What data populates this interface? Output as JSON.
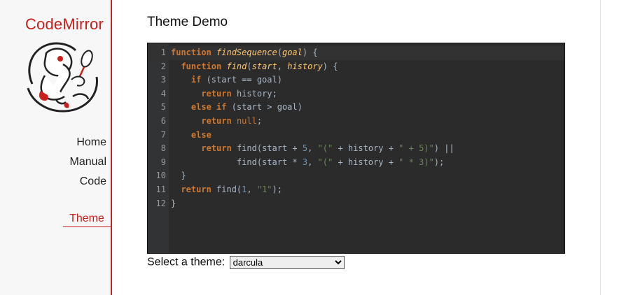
{
  "sidebar": {
    "brand": "CodeMirror",
    "nav": [
      {
        "label": "Home"
      },
      {
        "label": "Manual"
      },
      {
        "label": "Code"
      },
      {
        "label": "Theme",
        "active": true
      }
    ]
  },
  "main": {
    "title": "Theme Demo",
    "theme_label": "Select a theme:",
    "theme_selected": "darcula"
  },
  "editor": {
    "theme": "darcula",
    "line_numbers": [
      "1",
      "2",
      "3",
      "4",
      "5",
      "6",
      "7",
      "8",
      "9",
      "10",
      "11",
      "12"
    ],
    "colors": {
      "background": "#2b2b2b",
      "gutter": "#313335",
      "keyword": "#cc7832",
      "definition": "#ffc66d",
      "string": "#6a8759",
      "number": "#6897bb",
      "text": "#a9b7c6"
    }
  }
}
